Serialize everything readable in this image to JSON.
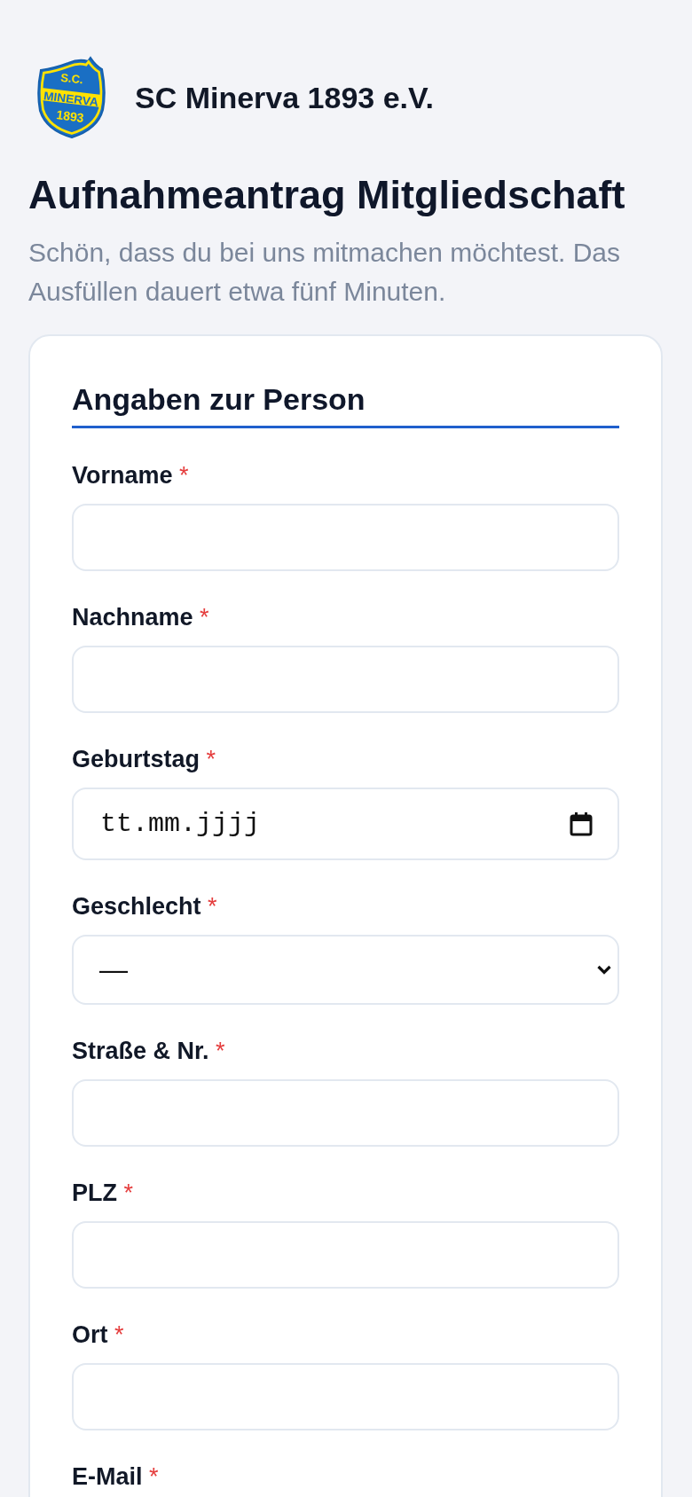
{
  "header": {
    "logo": {
      "top_text": "S.C.",
      "band_text": "MINERVA",
      "bottom_text": "1893"
    },
    "club_name": "SC Minerva 1893 e.V."
  },
  "intro": {
    "title": "Aufnahmeantrag Mitgliedschaft",
    "subtitle": "Schön, dass du bei uns mitmachen möchtest. Das Ausfüllen dauert etwa fünf Minuten."
  },
  "form": {
    "section_title": "Angaben zur Person",
    "fields": [
      {
        "kind": "text",
        "label": "Vorname",
        "required_mark": "*"
      },
      {
        "kind": "text",
        "label": "Nachname",
        "required_mark": "*"
      },
      {
        "kind": "date",
        "label": "Geburtstag",
        "required_mark": "*",
        "placeholder": "tt.mm.jjjj"
      },
      {
        "kind": "select",
        "label": "Geschlecht",
        "required_mark": "*",
        "value": "—"
      },
      {
        "kind": "text",
        "label": "Straße & Nr.",
        "required_mark": "*"
      },
      {
        "kind": "text",
        "label": "PLZ",
        "required_mark": "*"
      },
      {
        "kind": "text",
        "label": "Ort",
        "required_mark": "*"
      },
      {
        "kind": "text",
        "label": "E-Mail",
        "required_mark": "*"
      }
    ]
  }
}
